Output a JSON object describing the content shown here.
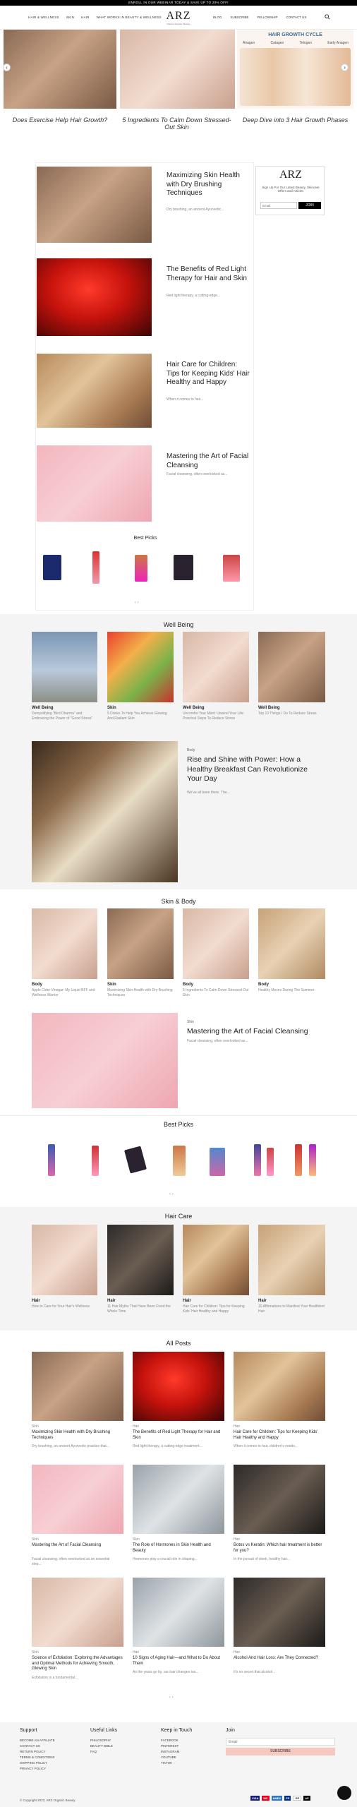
{
  "topbar": {
    "text": "ENROLL IN OUR WEBINAR TODAY & SAVE UP TO 20% OFF!",
    "bg": "#000000"
  },
  "nav": {
    "left": [
      "HAIR & WELLNESS",
      "SKIN",
      "HAIR",
      "WHAT WORKS IN BEAUTY & WELLNESS"
    ],
    "right": [
      "BLOG",
      "SUBSCRIBE",
      "FELLOWSHIP",
      "CONTACT US"
    ],
    "logo": "ARZ",
    "logo_sub": "Natural Organic Beauty",
    "search_icon": "search-icon"
  },
  "hero": {
    "slides": [
      {
        "title": "Does Exercise Help Hair Growth?"
      },
      {
        "title": "5 Ingredients To Calm Down Stressed-Out Skin"
      },
      {
        "title": "Deep Dive into 3 Hair Growth Phases"
      }
    ],
    "cycle_title": "HAIR GROWTH CYCLE",
    "cycle_labels": [
      "Anagen",
      "Catagen",
      "Telogen",
      "Early Anagen"
    ]
  },
  "featured": [
    {
      "title": "Maximizing Skin Health with Dry Brushing Techniques",
      "excerpt": "Dry brushing, an ancient Ayurvedic..."
    },
    {
      "title": "The Benefits of Red Light Therapy for Hair and Skin",
      "excerpt": "Red light therapy, a cutting-edge..."
    },
    {
      "title": "Hair Care for Children: Tips for Keeping Kids' Hair Healthy and Happy",
      "excerpt": "When it comes to hair..."
    },
    {
      "title": "Mastering the Art of Facial Cleansing",
      "excerpt": "Facial cleansing, often overlooked as..."
    }
  ],
  "newsletter": {
    "logo": "ARZ",
    "text": "Sign Up For Our Latest Beauty, Skincare Offers and Articles",
    "placeholder": "Email",
    "button": "JOIN"
  },
  "best_picks_small": {
    "title": "Best Picks"
  },
  "wellbeing": {
    "title": "Well Being",
    "items": [
      {
        "tag": "Well Being",
        "title": "Demystifying \"Bird Dharma\" and Embracing the Power of \"Good Stress\""
      },
      {
        "tag": "Skin",
        "title": "5 Drinks To Help You Achieve Glowing And Radiant Skin"
      },
      {
        "tag": "Well Being",
        "title": "Uncomfor Your Mind: Unwind Your Life: Practical Steps To Reduce Stress"
      },
      {
        "tag": "Well Being",
        "title": "Top 10 Things I Do To Reduce Stress"
      }
    ]
  },
  "breakfast": {
    "tag": "Body",
    "title": "Rise and Shine with Power: How a Healthy Breakfast Can Revolutionize Your Day",
    "excerpt": "We've all been there. The..."
  },
  "skinbody": {
    "title": "Skin & Body",
    "items": [
      {
        "tag": "Body",
        "title": "Apple Cider Vinegar: My Liquid BFF and Wellness Warrior"
      },
      {
        "tag": "Skin",
        "title": "Maximizing Skin Health with Dry Brushing Techniques"
      },
      {
        "tag": "Body",
        "title": "5 Ingredients To Calm Down Stressed-Out Skin"
      },
      {
        "tag": "Body",
        "title": "Healthy Moves During The Summer"
      }
    ]
  },
  "facial": {
    "tag": "Skin",
    "title": "Mastering the Art of Facial Cleansing",
    "excerpt": "Facial cleansing, often overlooked as..."
  },
  "best_picks": {
    "title": "Best Picks"
  },
  "haircare": {
    "title": "Hair Care",
    "items": [
      {
        "tag": "Hair",
        "title": "How to Care for Your Hair's Wellness"
      },
      {
        "tag": "Hair",
        "title": "11 Hair Myths That Have Been Fixed the Whole Time"
      },
      {
        "tag": "Hair",
        "title": "Hair Care for Children: Tips for Keeping Kids' Hair Healthy and Happy"
      },
      {
        "tag": "Hair",
        "title": "10 Affirmations to Manifest Your Healthiest Hair"
      }
    ]
  },
  "allposts": {
    "title": "All Posts",
    "items": [
      {
        "tag": "Skin",
        "title": "Maximizing Skin Health with Dry Brushing Techniques",
        "excerpt": "Dry brushing, an ancient Ayurvedic practice that..."
      },
      {
        "tag": "Hair",
        "title": "The Benefits of Red Light Therapy for Hair and Skin",
        "excerpt": "Red light therapy, a cutting-edge treatment..."
      },
      {
        "tag": "Hair",
        "title": "Hair Care for Children: Tips for Keeping Kids' Hair Healthy and Happy",
        "excerpt": "When it comes to hair, children's needs..."
      },
      {
        "tag": "Skin",
        "title": "Mastering the Art of Facial Cleansing",
        "excerpt": "Facial cleansing, often overlooked as an essential step..."
      },
      {
        "tag": "Skin",
        "title": "The Role of Hormones in Skin Health and Beauty",
        "excerpt": "Hormones play a crucial role in shaping..."
      },
      {
        "tag": "Hair",
        "title": "Botox vs Keratin: Which hair treatment is better for you?",
        "excerpt": "In the pursuit of sleek, healthy hair..."
      },
      {
        "tag": "Skin",
        "title": "Science of Exfoliation: Exploring the Advantages and Optimal Methods for Achieving Smooth, Glowing Skin",
        "excerpt": "Exfoliation is a fundamental..."
      },
      {
        "tag": "Hair",
        "title": "10 Signs of Aging Hair—and What to Do About Them",
        "excerpt": "As the years go by, our hair changes too..."
      },
      {
        "tag": "Hair",
        "title": "Alcohol And Hair Loss: Are They Connected?",
        "excerpt": "It's no secret that alcohol..."
      }
    ]
  },
  "footer": {
    "support": {
      "title": "Support",
      "links": [
        "BECOME AN AFFILIATE",
        "CONTACT US",
        "RETURN POLICY",
        "TERMS & CONDITIONS",
        "SHIPPING POLICY",
        "PRIVACY POLICY"
      ]
    },
    "useful": {
      "title": "Useful Links",
      "links": [
        "PHILOSOPHY",
        "BEAUTY BIBLE",
        "FAQ"
      ]
    },
    "touch": {
      "title": "Keep in Touch",
      "links": [
        "FACEBOOK",
        "PINTEREST",
        "INSTAGRAM",
        "YOUTUBE",
        "TIKTOK"
      ]
    },
    "join": {
      "title": "Join",
      "placeholder": "Email",
      "button": "SUBSCRIBE"
    },
    "copyright": "© Copyright 2023, ARZ Organic Beauty",
    "payments": [
      "VISA",
      "MC",
      "AMEX",
      "PP",
      "GP",
      "AP"
    ]
  },
  "accent": "#f5c9c0"
}
